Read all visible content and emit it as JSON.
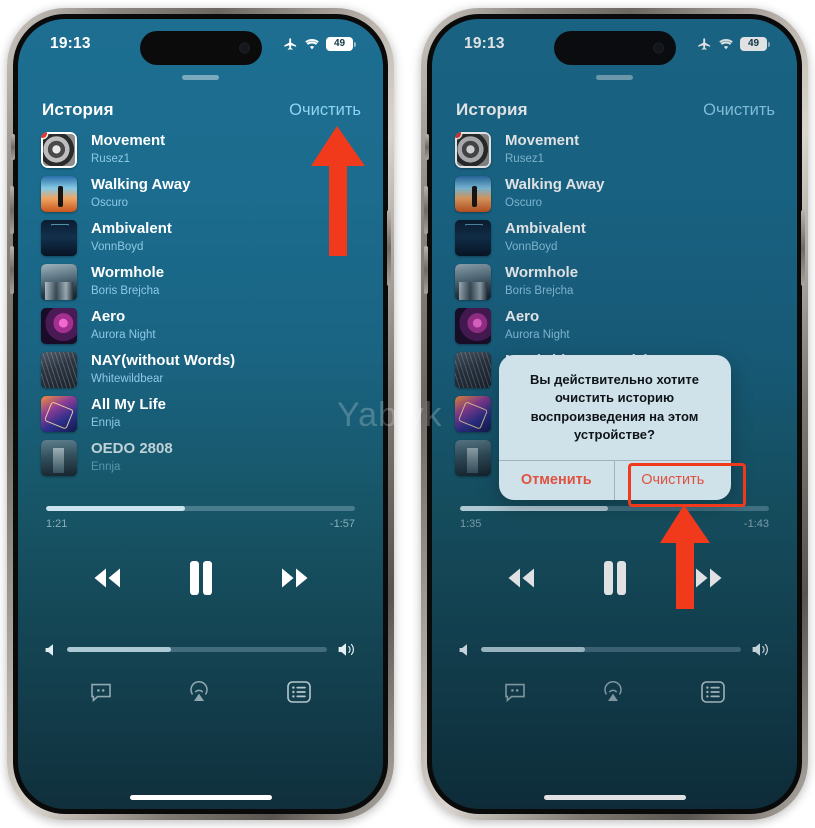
{
  "meta": {
    "watermark": "Yablyk"
  },
  "status_bar": {
    "time": "19:13",
    "airplane_icon": "airplane-mode-icon",
    "wifi_icon": "wifi-icon",
    "battery_level": "49"
  },
  "history": {
    "title": "История",
    "clear_label": "Очистить",
    "tracks": [
      {
        "title": "Movement",
        "artist": "Rusez1",
        "art": "ar1"
      },
      {
        "title": "Walking Away",
        "artist": "Oscuro",
        "art": "ar2"
      },
      {
        "title": "Ambivalent",
        "artist": "VonnBoyd",
        "art": "ar3"
      },
      {
        "title": "Wormhole",
        "artist": "Boris Brejcha",
        "art": "ar4"
      },
      {
        "title": "Aero",
        "artist": "Aurora Night",
        "art": "ar5"
      },
      {
        "title": "NAY(without Words)",
        "artist": "Whitewildbear",
        "art": "ar6"
      },
      {
        "title": "All My Life",
        "artist": "Ennja",
        "art": "ar7"
      },
      {
        "title": "OEDO 2808",
        "artist": "Ennja",
        "art": "ar8"
      }
    ]
  },
  "player_left": {
    "elapsed": "1:21",
    "remaining": "-1:57",
    "progress_percent": 45,
    "volume_percent": 40,
    "rewind_icon": "rewind-icon",
    "pause_icon": "pause-icon",
    "forward_icon": "fast-forward-icon",
    "volume_low_icon": "volume-low-icon",
    "volume_high_icon": "volume-high-icon",
    "lyrics_icon": "lyrics-icon",
    "airplay_icon": "airplay-icon",
    "queue_icon": "queue-list-icon"
  },
  "player_right": {
    "elapsed": "1:35",
    "remaining": "-1:43",
    "progress_percent": 48,
    "volume_percent": 40
  },
  "alert": {
    "message": "Вы действительно хотите очистить историю воспроизведения на этом устройстве?",
    "cancel_label": "Отменить",
    "confirm_label": "Очистить"
  },
  "annotations": {
    "arrow_color": "#f1391b",
    "highlight_color": "#f1391b"
  }
}
